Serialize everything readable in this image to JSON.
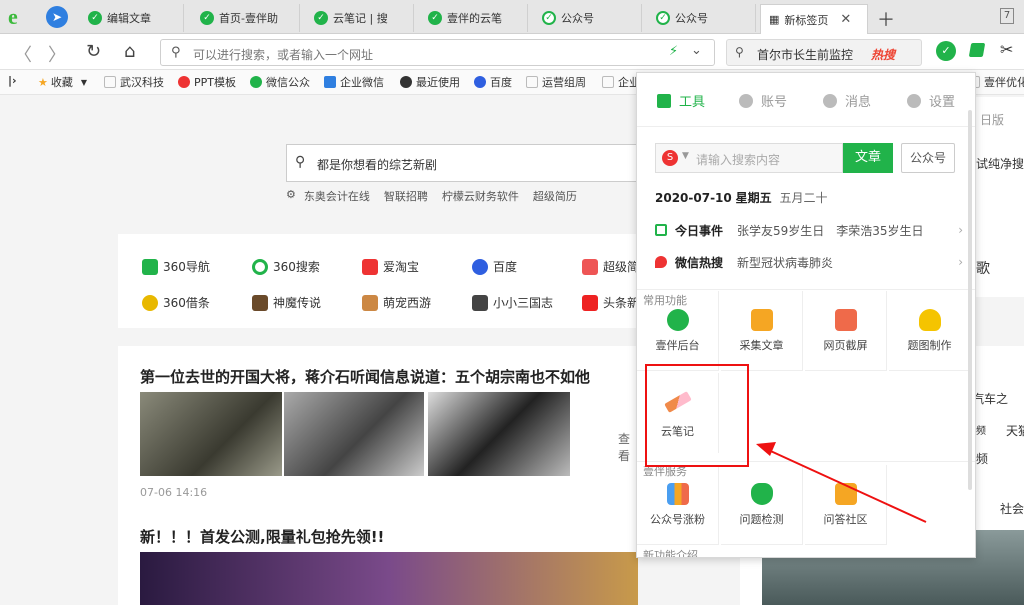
{
  "tabs": [
    {
      "label": "编辑文章",
      "icon": "yiban-icon"
    },
    {
      "label": "首页-壹伴助",
      "icon": "yiban-icon"
    },
    {
      "label": "云笔记 | 搜",
      "icon": "yiban-icon"
    },
    {
      "label": "壹伴的云笔",
      "icon": "yiban-icon"
    },
    {
      "label": "公众号",
      "icon": "wechat-icon"
    },
    {
      "label": "公众号",
      "icon": "wechat-icon"
    },
    {
      "label": "新标签页",
      "icon": "grid-icon",
      "active": true
    }
  ],
  "window_count": "7",
  "address": {
    "placeholder": "可以进行搜索，或者输入一个网址"
  },
  "hot_search": {
    "text": "首尔市长生前监控",
    "tag": "热搜"
  },
  "bookmarks": [
    {
      "label": "收藏",
      "icon": "star-icon"
    },
    {
      "label": "武汉科技",
      "icon": "page-icon"
    },
    {
      "label": "PPT模板",
      "icon": "pin-icon"
    },
    {
      "label": "微信公众",
      "icon": "yiban-icon"
    },
    {
      "label": "企业微信",
      "icon": "chat-icon"
    },
    {
      "label": "最近使用",
      "icon": "clock-icon"
    },
    {
      "label": "百度",
      "icon": "baidu-icon"
    },
    {
      "label": "运营组周",
      "icon": "page-icon"
    },
    {
      "label": "企业",
      "icon": "page-icon"
    },
    {
      "label": "壹伴优化",
      "icon": "page-icon"
    }
  ],
  "page": {
    "search_placeholder": "都是你想看的综艺新剧",
    "quick_links": [
      "东奥会计在线",
      "智联招聘",
      "柠檬云财务软件",
      "超级简历"
    ],
    "sites_row1": [
      "360导航",
      "360搜索",
      "爱淘宝",
      "百度",
      "超级简"
    ],
    "sites_row2": [
      "360借条",
      "神魔传说",
      "萌宠西游",
      "小小三国志",
      "头条新"
    ],
    "news_title": "第一位去世的开国大将，蒋介石听闻信息说道：五个胡宗南也不如他",
    "news_more": "查看",
    "news_time": "07-06 14:16",
    "news2_title": "新！！！首发公测,限量礼包抢先领!!",
    "right_texts": [
      "歌",
      "汽车之",
      "频",
      "天猫",
      "频",
      "社会",
      "日版",
      "试纯净搜"
    ]
  },
  "popup": {
    "tabs": [
      {
        "label": "工具",
        "icon": "grid-icon",
        "active": true
      },
      {
        "label": "账号",
        "icon": "user-icon"
      },
      {
        "label": "消息",
        "icon": "message-icon"
      },
      {
        "label": "设置",
        "icon": "gear-icon"
      }
    ],
    "search_placeholder": "请输入搜索内容",
    "btn_article": "文章",
    "btn_gzh": "公众号",
    "date": "2020-07-10",
    "weekday": "星期五",
    "lunar": "五月二十",
    "today_label": "今日事件",
    "today_text": "张学友59岁生日　李荣浩35岁生日",
    "hot_label": "微信热搜",
    "hot_text": "新型冠状病毒肺炎",
    "section_common": "常用功能",
    "tools_row1": [
      "壹伴后台",
      "采集文章",
      "网页截屏",
      "题图制作"
    ],
    "tool_highlight": "云笔记",
    "section_services": "壹伴服务",
    "tools_row3": [
      "公众号涨粉",
      "问题检测",
      "问答社区"
    ],
    "section_new": "新功能介绍"
  }
}
